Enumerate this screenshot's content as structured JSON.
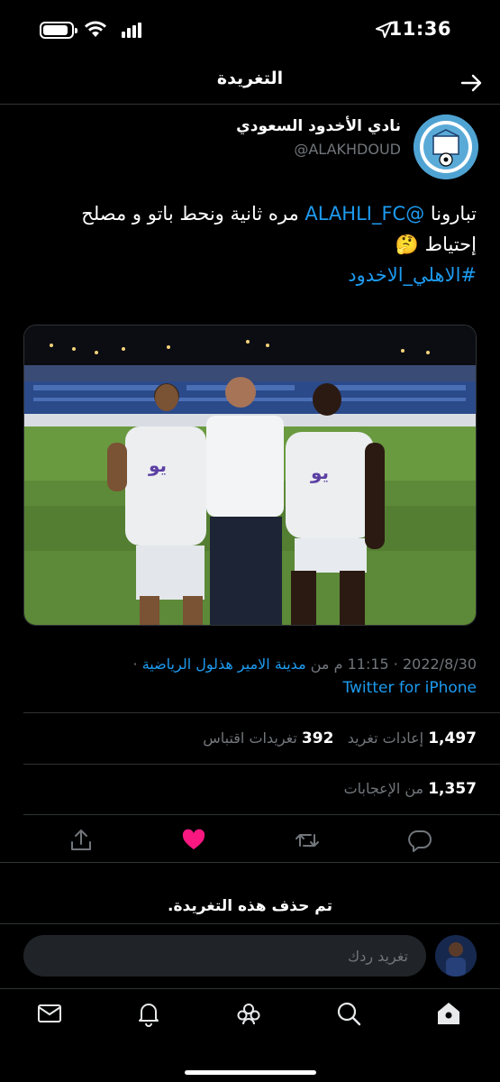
{
  "status_bar": {
    "time": "11:36"
  },
  "topbar": {
    "title": "التغريدة"
  },
  "tweet": {
    "display_name": "نادي الأخدود السعودي",
    "handle": "@ALAKHDOUD",
    "text_part1": "تبارونا ",
    "mention": "@ALAHLI_FC",
    "text_part2": " مره ثانية ونحط باتو و مصلح إحتياط 🤔",
    "hashtag": "#الاهلي_الاخدود",
    "date": "2022/8/30",
    "time": "11:15 م",
    "location_prefix": "من",
    "location": "مدينة الامير هذلول الرياضية",
    "source": "Twitter for iPhone"
  },
  "stats": {
    "retweets_count": "1,497",
    "retweets_label": "إعادات تغريد",
    "quotes_count": "392",
    "quotes_label": "تغريدات اقتباس",
    "likes_count": "1,357",
    "likes_label": "من الإعجابات"
  },
  "deleted_note": "تم حذف هذه التغريدة.",
  "reply": {
    "placeholder": "تغريد ردك"
  },
  "colors": {
    "accent": "#1d9bf0",
    "like": "#f91880",
    "background": "#000000"
  },
  "icons": {
    "actions": [
      "share-icon",
      "heart-icon",
      "retweet-icon",
      "reply-icon"
    ],
    "tabs": [
      "messages-icon",
      "notifications-icon",
      "communities-icon",
      "search-icon",
      "home-icon"
    ]
  }
}
